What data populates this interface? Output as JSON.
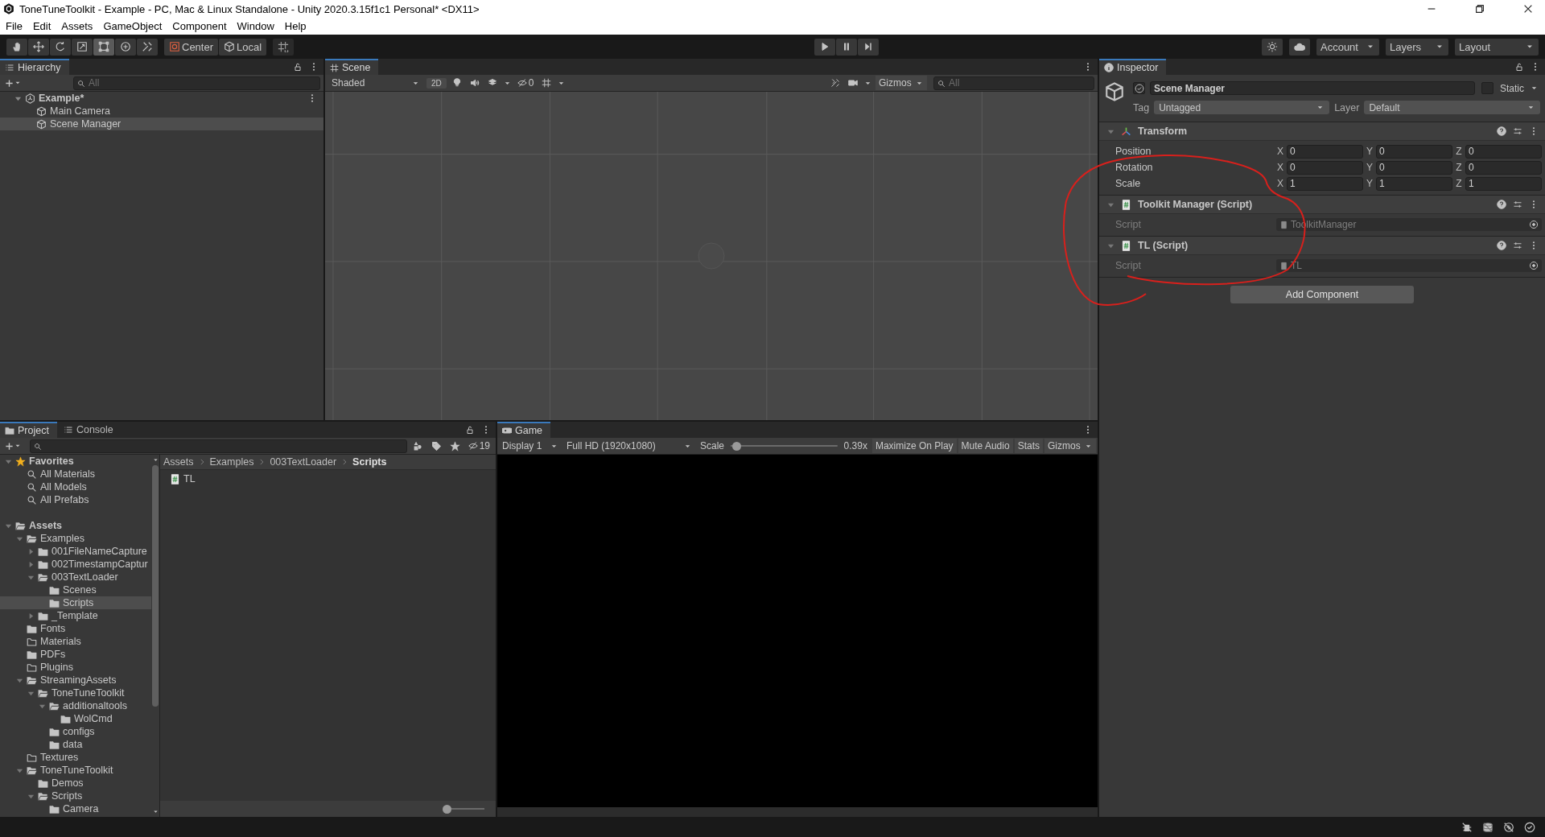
{
  "window": {
    "title": "ToneTuneToolkit - Example - PC, Mac & Linux Standalone - Unity 2020.3.15f1c1 Personal* <DX11>"
  },
  "menu": [
    "File",
    "Edit",
    "Assets",
    "GameObject",
    "Component",
    "Window",
    "Help"
  ],
  "toolbar": {
    "tools": [
      {
        "kind": "hand",
        "selected": false
      },
      {
        "kind": "move",
        "selected": false
      },
      {
        "kind": "rotate",
        "selected": false
      },
      {
        "kind": "scale",
        "selected": false
      },
      {
        "kind": "rect",
        "selected": true
      },
      {
        "kind": "transform",
        "selected": false
      },
      {
        "kind": "custom",
        "selected": false
      }
    ],
    "pivot": "Center",
    "space": "Local",
    "account": "Account",
    "layers": "Layers",
    "layout": "Layout"
  },
  "hierarchy": {
    "tab": "Hierarchy",
    "search": {
      "placeholder": "All"
    },
    "tree": [
      {
        "label": "Example*",
        "kind": "scene",
        "expanded": true,
        "selected": false,
        "children": [
          {
            "label": "Main Camera",
            "kind": "object",
            "selected": false
          },
          {
            "label": "Scene Manager",
            "kind": "object",
            "selected": true
          }
        ]
      }
    ]
  },
  "scene": {
    "tab": "Scene",
    "shading": "Shaded",
    "mode_2d": "2D",
    "hidden_count": "0",
    "gizmos": "Gizmos",
    "search": {
      "placeholder": "All"
    }
  },
  "inspector": {
    "tab": "Inspector",
    "object": {
      "active": true,
      "name": "Scene Manager",
      "static": false,
      "static_label": "Static",
      "tag_label": "Tag",
      "tag": "Untagged",
      "layer_label": "Layer",
      "layer": "Default"
    },
    "components": [
      {
        "kind": "transform",
        "title": "Transform",
        "expanded": true,
        "rows": [
          {
            "label": "Position",
            "axes": [
              "X",
              "Y",
              "Z"
            ],
            "values": [
              "0",
              "0",
              "0"
            ]
          },
          {
            "label": "Rotation",
            "axes": [
              "X",
              "Y",
              "Z"
            ],
            "values": [
              "0",
              "0",
              "0"
            ]
          },
          {
            "label": "Scale",
            "axes": [
              "X",
              "Y",
              "Z"
            ],
            "values": [
              "1",
              "1",
              "1"
            ]
          }
        ]
      },
      {
        "kind": "script",
        "title": "Toolkit Manager (Script)",
        "expanded": true,
        "field_label": "Script",
        "value": "ToolkitManager"
      },
      {
        "kind": "script",
        "title": "TL (Script)",
        "expanded": true,
        "field_label": "Script",
        "value": "TL"
      }
    ],
    "add_button": "Add Component"
  },
  "project": {
    "tabs": [
      {
        "label": "Project",
        "selected": true,
        "kind": "project"
      },
      {
        "label": "Console",
        "selected": false,
        "kind": "console"
      }
    ],
    "hidden_count": "19",
    "tree": [
      {
        "label": "Favorites",
        "kind": "star",
        "bold": true,
        "expanded": true,
        "selected": false,
        "children": [
          {
            "label": "All Materials",
            "kind": "search",
            "selected": false
          },
          {
            "label": "All Models",
            "kind": "search",
            "selected": false
          },
          {
            "label": "All Prefabs",
            "kind": "search",
            "selected": false
          }
        ]
      },
      {
        "label": "Assets",
        "kind": "folder-open",
        "bold": true,
        "expanded": true,
        "selected": false,
        "children": [
          {
            "label": "Examples",
            "kind": "folder-open",
            "expanded": true,
            "selected": false,
            "children": [
              {
                "label": "001FileNameCapture",
                "kind": "folder",
                "expanded": false,
                "selected": false
              },
              {
                "label": "002TimestampCaptur",
                "kind": "folder",
                "expanded": false,
                "selected": false
              },
              {
                "label": "003TextLoader",
                "kind": "folder-open",
                "expanded": true,
                "selected": false,
                "children": [
                  {
                    "label": "Scenes",
                    "kind": "folder",
                    "selected": false
                  },
                  {
                    "label": "Scripts",
                    "kind": "folder",
                    "selected": true
                  }
                ]
              },
              {
                "label": "_Template",
                "kind": "folder",
                "expanded": false,
                "selected": false
              }
            ]
          },
          {
            "label": "Fonts",
            "kind": "folder",
            "selected": false
          },
          {
            "label": "Materials",
            "kind": "folder-empty",
            "selected": false
          },
          {
            "label": "PDFs",
            "kind": "folder",
            "selected": false
          },
          {
            "label": "Plugins",
            "kind": "folder-empty",
            "selected": false
          },
          {
            "label": "StreamingAssets",
            "kind": "folder-open",
            "expanded": true,
            "selected": false,
            "children": [
              {
                "label": "ToneTuneToolkit",
                "kind": "folder-open",
                "expanded": true,
                "selected": false,
                "children": [
                  {
                    "label": "additionaltools",
                    "kind": "folder-open",
                    "expanded": true,
                    "selected": false,
                    "children": [
                      {
                        "label": "WolCmd",
                        "kind": "folder",
                        "selected": false
                      }
                    ]
                  },
                  {
                    "label": "configs",
                    "kind": "folder",
                    "selected": false
                  },
                  {
                    "label": "data",
                    "kind": "folder",
                    "selected": false
                  }
                ]
              }
            ]
          },
          {
            "label": "Textures",
            "kind": "folder-empty",
            "selected": false
          },
          {
            "label": "ToneTuneToolkit",
            "kind": "folder-open",
            "expanded": true,
            "selected": false,
            "children": [
              {
                "label": "Demos",
                "kind": "folder",
                "selected": false
              },
              {
                "label": "Scripts",
                "kind": "folder-open",
                "expanded": true,
                "selected": false,
                "children": [
                  {
                    "label": "Camera",
                    "kind": "folder",
                    "selected": false
                  }
                ]
              }
            ]
          }
        ]
      }
    ],
    "breadcrumb": [
      "Assets",
      "Examples",
      "003TextLoader",
      "Scripts"
    ],
    "files": [
      {
        "name": "TL",
        "kind": "script"
      }
    ],
    "zoom": {
      "level": 0.05
    }
  },
  "game": {
    "tab": "Game",
    "display": "Display 1",
    "resolution": "Full HD (1920x1080)",
    "scale_label": "Scale",
    "scale": {
      "level": 0.05
    },
    "scale_value": "0.39x",
    "toggles": [
      "Maximize On Play",
      "Mute Audio",
      "Stats"
    ],
    "gizmos": "Gizmos"
  }
}
